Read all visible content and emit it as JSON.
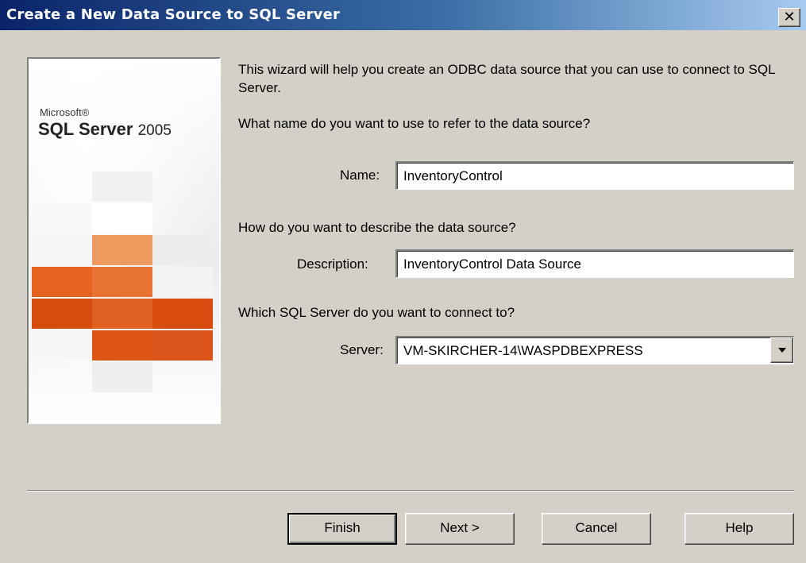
{
  "window": {
    "title": "Create a New Data Source to SQL Server",
    "close_glyph": "✕"
  },
  "banner": {
    "brand_small": "Microsoft®",
    "brand_large": "SQL Server",
    "brand_year": "2005"
  },
  "intro_text": "This wizard will help you create an ODBC data source that you can use to connect to SQL Server.",
  "name_section": {
    "question": "What name do you want to use to refer to the data source?",
    "label": "Name:",
    "value": "InventoryControl"
  },
  "description_section": {
    "question": "How do you want to describe the data source?",
    "label": "Description:",
    "value": "InventoryControl Data Source"
  },
  "server_section": {
    "question": "Which SQL Server do you want to connect to?",
    "label": "Server:",
    "value": "VM-SKIRCHER-14\\WASPDBEXPRESS"
  },
  "buttons": {
    "finish": "Finish",
    "next": "Next >",
    "cancel": "Cancel",
    "help": "Help"
  },
  "colors": {
    "titlebar_start": "#0a246a",
    "titlebar_end": "#a6caf0",
    "dialog_bg": "#d4d0c8",
    "tile_orange_dark": "#d94e12",
    "tile_orange_light": "#f09a60"
  }
}
